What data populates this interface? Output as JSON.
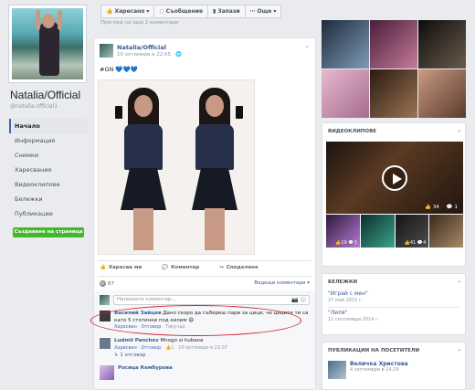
{
  "page": {
    "name": "Natalia/Official",
    "handle": "@natalia.official1"
  },
  "nav": {
    "items": [
      {
        "label": "Начало"
      },
      {
        "label": "Информация"
      },
      {
        "label": "Снимки"
      },
      {
        "label": "Харесвания"
      },
      {
        "label": "Видеоклипове"
      },
      {
        "label": "Бележки"
      },
      {
        "label": "Публикации"
      }
    ],
    "create_page": "Създаване на страница"
  },
  "actionbar": {
    "liked": "Харесано",
    "message": "Съобщение",
    "saves": "Запази",
    "more": "Още"
  },
  "prev_link": "Преглед на още 2 коментари",
  "post": {
    "author": "Natalia/Official",
    "time": "10 октомври в 22:05 · ",
    "text": "#GN ",
    "hearts": "💙💙💙",
    "actions": {
      "like": "Харесва ми",
      "comment": "Коментар",
      "share": "Споделяне"
    },
    "likes": "87",
    "top_comments": "Водещи коментари"
  },
  "comments": {
    "write_placeholder": "Напишете коментар...",
    "items": [
      {
        "name": "Василий Зайцев",
        "text": "Дано скоро да събереш пари за цици, че циците ти са като 5 стотинки под килим",
        "meta_like": "Харесван",
        "meta_reply": "Отговор",
        "meta_time": "Току-що"
      },
      {
        "name": "Ludmil Panchev",
        "text": "Mnogo si hubava",
        "meta_like": "Харесван",
        "meta_reply": "Отговор",
        "meta_count": "1",
        "meta_time": "10 октомври в 22:07"
      },
      {
        "name": "Росица Кембурова",
        "text": ""
      }
    ],
    "replies": "1 отговор"
  },
  "right": {
    "videos_title": "ВИДЕОКЛИПОВЕ",
    "video_main_stats": {
      "likes": "34",
      "comments": "1"
    },
    "video_thumbs": [
      {
        "likes": "19",
        "comments": "3"
      },
      {
        "likes": "",
        "comments": ""
      },
      {
        "likes": "41",
        "comments": "4"
      },
      {
        "likes": "",
        "comments": ""
      }
    ],
    "notes_title": "БЕЛЕЖКИ",
    "notes": [
      {
        "title": "\"Играй с мен\"",
        "date": "27 май 2015 г."
      },
      {
        "title": "\"Лиля\"",
        "date": "11 септември 2014 г."
      }
    ],
    "visitors_title": "ПУБЛИКАЦИИ НА ПОСЕТИТЕЛИ",
    "visitor": {
      "name": "Величка Христова",
      "date": "4 септември в 14:29"
    }
  },
  "colors": {
    "link": "#365899",
    "accent": "#4267b2",
    "green": "#42b72a",
    "annotation": "#d6262d"
  }
}
